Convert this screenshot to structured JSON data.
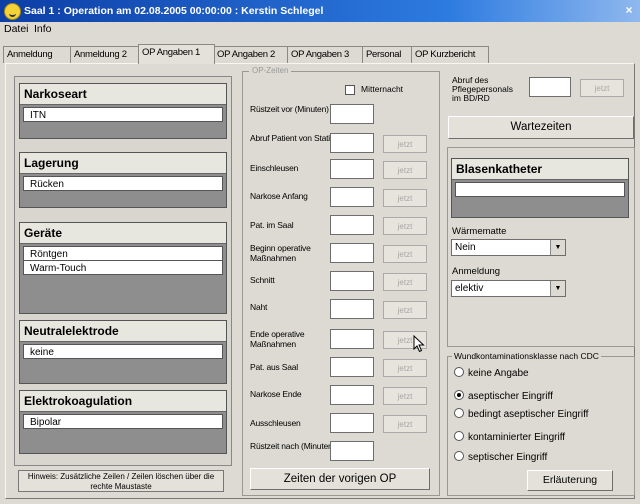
{
  "window": {
    "title": "Saal 1 : Operation am 02.08.2005 00:00:00 : Kerstin Schlegel",
    "close_glyph": "×"
  },
  "menu": [
    "Datei",
    "Info"
  ],
  "tabs": [
    {
      "label": "Anmeldung",
      "active": false
    },
    {
      "label": "Anmeldung 2",
      "active": false
    },
    {
      "label": "OP Angaben 1",
      "active": true
    },
    {
      "label": "OP Angaben 2",
      "active": false
    },
    {
      "label": "OP Angaben 3",
      "active": false
    },
    {
      "label": "Personal",
      "active": false
    },
    {
      "label": "OP Kurzbericht",
      "active": false
    }
  ],
  "left_groups": [
    {
      "title": "Narkoseart",
      "items": [
        "ITN"
      ]
    },
    {
      "title": "Lagerung",
      "items": [
        "Rücken"
      ]
    },
    {
      "title": "Geräte",
      "items": [
        "Röntgen",
        "Warm-Touch"
      ]
    },
    {
      "title": "Neutralelektrode",
      "items": [
        "keine"
      ]
    },
    {
      "title": "Elektrokoagulation",
      "items": [
        "Bipolar"
      ]
    }
  ],
  "hint": "Hinweis: Zusätzliche Zeilen / Zeilen löschen über die rechte Maustaste",
  "op_zeiten": {
    "legend": "OP-Zeiten",
    "mitternacht_label": "Mitternacht",
    "jetzt_label": "jetzt",
    "rows": [
      {
        "label": "Rüstzeit vor (Minuten)",
        "jetzt": false
      },
      {
        "label": "Abruf Patient von Station",
        "jetzt": true
      },
      {
        "label": "Einschleusen",
        "jetzt": true
      },
      {
        "label": "Narkose Anfang",
        "jetzt": true
      },
      {
        "label": "Pat. im Saal",
        "jetzt": true
      },
      {
        "label": "Beginn operative Maßnahmen",
        "jetzt": true
      },
      {
        "label": "Schnitt",
        "jetzt": true
      },
      {
        "label": "Naht",
        "jetzt": true
      },
      {
        "label": "Ende operative Maßnahmen",
        "jetzt": true
      },
      {
        "label": "Pat. aus Saal",
        "jetzt": true
      },
      {
        "label": "Narkose Ende",
        "jetzt": true
      },
      {
        "label": "Ausschleusen",
        "jetzt": true
      },
      {
        "label": "Rüstzeit nach (Minuten)",
        "jetzt": false
      }
    ],
    "prev_button": "Zeiten der vorigen OP"
  },
  "right": {
    "abruf_label": "Abruf des Pflegepersonals im BD/RD",
    "jetzt_label": "jetzt",
    "wartezeiten_button": "Wartezeiten",
    "blasenkatheter_title": "Blasenkatheter",
    "waermematte_label": "Wärmematte",
    "waermematte_value": "Nein",
    "anmeldung_label": "Anmeldung",
    "anmeldung_value": "elektiv",
    "wund_legend": "Wundkontaminationsklasse nach CDC",
    "wund_options": [
      {
        "label": "keine Angabe",
        "selected": false
      },
      {
        "label": "aseptischer Eingriff",
        "selected": true
      },
      {
        "label": "bedingt aseptischer Eingriff",
        "selected": false
      },
      {
        "label": "kontaminierter Eingriff",
        "selected": false
      },
      {
        "label": "septischer Eingriff",
        "selected": false
      }
    ],
    "erlaeuterung_button": "Erläuterung"
  }
}
